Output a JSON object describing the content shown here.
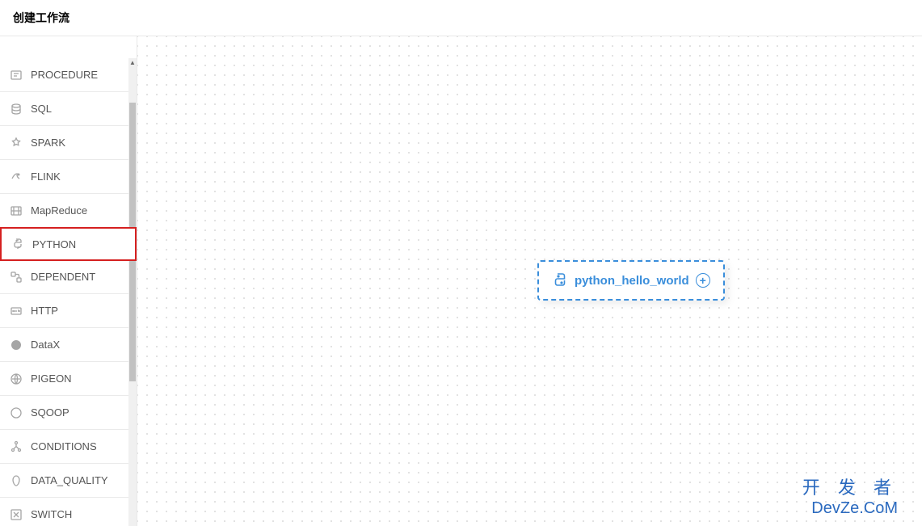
{
  "header": {
    "title": "创建工作流"
  },
  "sidebar": {
    "items": [
      {
        "label": "PROCEDURE",
        "icon": "procedure-icon",
        "selected": false
      },
      {
        "label": "SQL",
        "icon": "sql-icon",
        "selected": false
      },
      {
        "label": "SPARK",
        "icon": "spark-icon",
        "selected": false
      },
      {
        "label": "FLINK",
        "icon": "flink-icon",
        "selected": false
      },
      {
        "label": "MapReduce",
        "icon": "mapreduce-icon",
        "selected": false
      },
      {
        "label": "PYTHON",
        "icon": "python-icon",
        "selected": true
      },
      {
        "label": "DEPENDENT",
        "icon": "dependent-icon",
        "selected": false
      },
      {
        "label": "HTTP",
        "icon": "http-icon",
        "selected": false
      },
      {
        "label": "DataX",
        "icon": "datax-icon",
        "selected": false
      },
      {
        "label": "PIGEON",
        "icon": "pigeon-icon",
        "selected": false
      },
      {
        "label": "SQOOP",
        "icon": "sqoop-icon",
        "selected": false
      },
      {
        "label": "CONDITIONS",
        "icon": "conditions-icon",
        "selected": false
      },
      {
        "label": "DATA_QUALITY",
        "icon": "dataquality-icon",
        "selected": false
      },
      {
        "label": "SWITCH",
        "icon": "switch-icon",
        "selected": false
      }
    ]
  },
  "canvas": {
    "node": {
      "label": "python_hello_world",
      "icon": "python-icon"
    }
  },
  "watermark": {
    "line1": "开 发 者",
    "line2": "DevZe.CoM"
  }
}
